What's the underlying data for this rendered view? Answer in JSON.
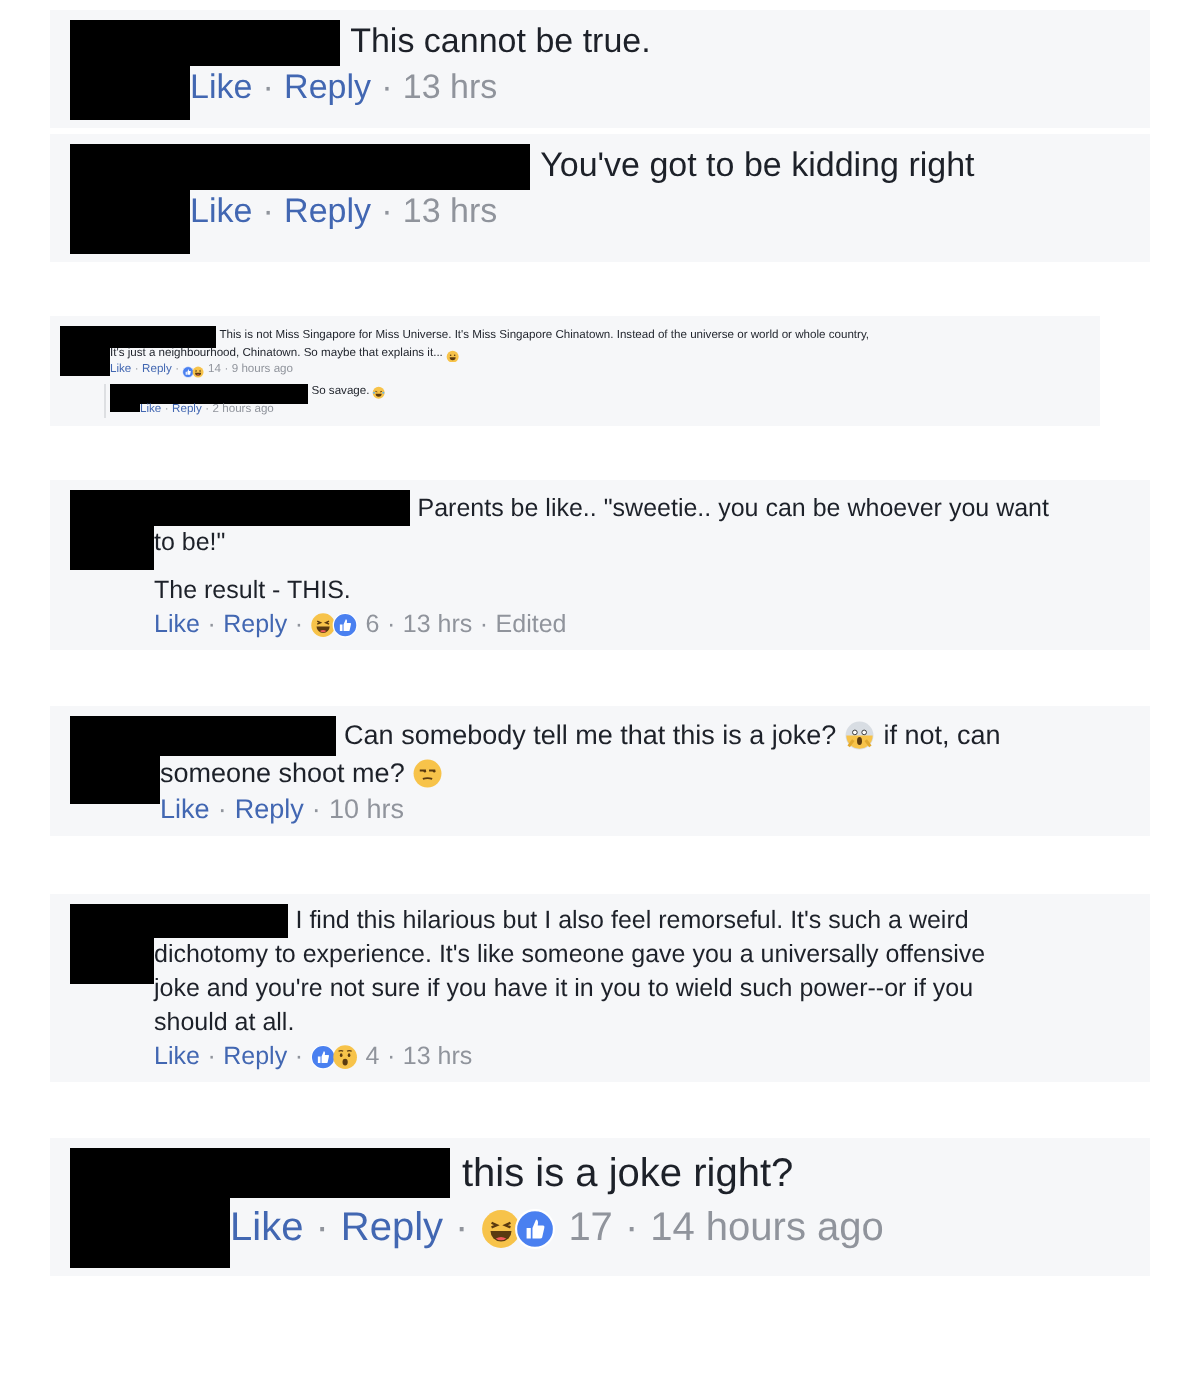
{
  "separator": "·",
  "comments": [
    {
      "paragraphs": [
        {
          "lines": [
            [
              {
                "kind": "text",
                "text": "This cannot be true."
              }
            ]
          ]
        }
      ],
      "actions": {
        "like": "Like",
        "reply": "Reply",
        "time": "13 hrs"
      }
    },
    {
      "paragraphs": [
        {
          "lines": [
            [
              {
                "kind": "text",
                "text": "You've got to be kidding right"
              }
            ]
          ]
        }
      ],
      "actions": {
        "like": "Like",
        "reply": "Reply",
        "time": "13 hrs"
      }
    },
    {
      "paragraphs": [
        {
          "lines": [
            [
              {
                "kind": "text",
                "text": "This is not Miss Singapore for Miss Universe. It's Miss Singapore Chinatown. Instead of the universe or world or whole country,"
              }
            ],
            [
              {
                "kind": "text",
                "text": "It's just a neighbourhood, Chinatown. So maybe that explains it..."
              },
              {
                "kind": "grin"
              }
            ]
          ]
        }
      ],
      "actions": {
        "like": "Like",
        "reply": "Reply",
        "reactions": [
          {
            "kind": "like"
          },
          {
            "kind": "haha"
          }
        ],
        "count": "14",
        "time": "9 hours ago"
      },
      "replies": [
        {
          "paragraphs": [
            {
              "lines": [
                [
                  {
                    "kind": "text",
                    "text": "So savage."
                  },
                  {
                    "kind": "laugh"
                  }
                ]
              ]
            }
          ],
          "actions": {
            "like": "Like",
            "reply": "Reply",
            "time": "2 hours ago"
          }
        }
      ]
    },
    {
      "paragraphs": [
        {
          "lines": [
            [
              {
                "kind": "text",
                "text": "Parents be like.. \"sweetie.. you can be whoever you want"
              }
            ],
            [
              {
                "kind": "text",
                "text": "to be!\""
              }
            ]
          ]
        },
        {
          "lines": [
            [
              {
                "kind": "text",
                "text": "The result - THIS."
              }
            ]
          ]
        }
      ],
      "actions": {
        "like": "Like",
        "reply": "Reply",
        "reactions": [
          {
            "kind": "haha"
          },
          {
            "kind": "like"
          }
        ],
        "count": "6",
        "time": "13 hrs",
        "edited": "Edited"
      }
    },
    {
      "paragraphs": [
        {
          "lines": [
            [
              {
                "kind": "text",
                "text": "Can somebody tell me that this is a joke?"
              },
              {
                "kind": "scream"
              },
              {
                "kind": "text",
                "text": "if not, can"
              }
            ],
            [
              {
                "kind": "text",
                "text": "someone shoot me?"
              },
              {
                "kind": "unamused"
              }
            ]
          ]
        }
      ],
      "actions": {
        "like": "Like",
        "reply": "Reply",
        "time": "10 hrs"
      }
    },
    {
      "paragraphs": [
        {
          "lines": [
            [
              {
                "kind": "text",
                "text": "I find this hilarious but I also feel remorseful. It's such a weird"
              }
            ],
            [
              {
                "kind": "text",
                "text": "dichotomy to experience. It's like someone gave you a universally offensive"
              }
            ],
            [
              {
                "kind": "text",
                "text": "joke and you're not sure if you have it in you to wield such power--or if you"
              }
            ],
            [
              {
                "kind": "text",
                "text": "should at all."
              }
            ]
          ]
        }
      ],
      "actions": {
        "like": "Like",
        "reply": "Reply",
        "reactions": [
          {
            "kind": "like"
          },
          {
            "kind": "wow"
          }
        ],
        "count": "4",
        "time": "13 hrs"
      }
    },
    {
      "paragraphs": [
        {
          "lines": [
            [
              {
                "kind": "text",
                "text": "this is a joke right?"
              }
            ]
          ]
        }
      ],
      "actions": {
        "like": "Like",
        "reply": "Reply",
        "reactions": [
          {
            "kind": "haha"
          },
          {
            "kind": "like"
          }
        ],
        "count": "17",
        "time": "14 hours ago"
      }
    }
  ]
}
